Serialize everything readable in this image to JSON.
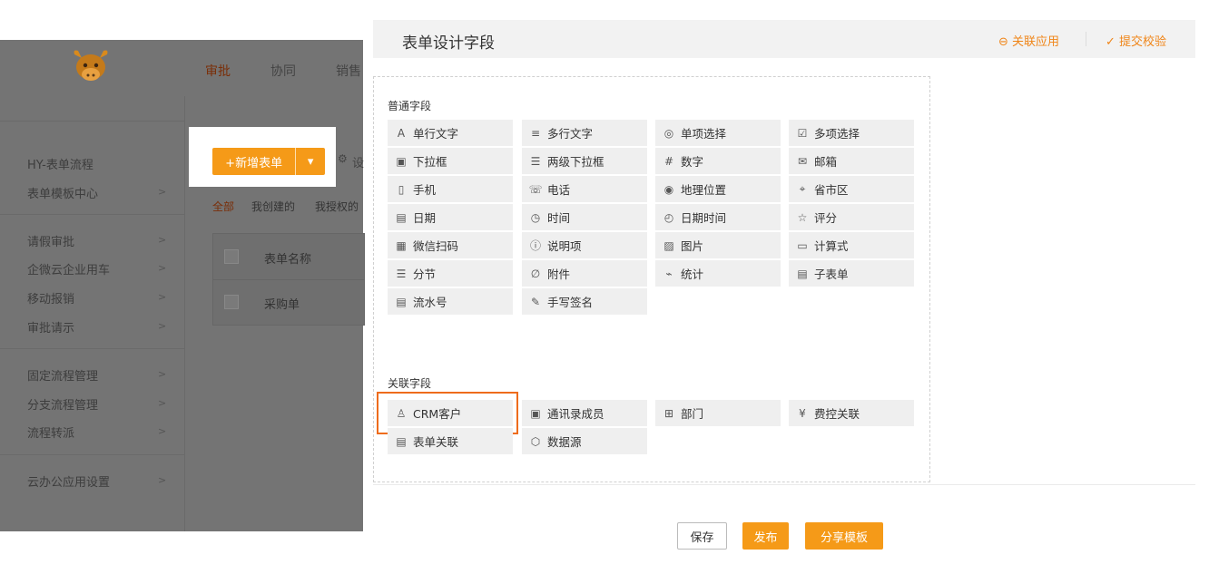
{
  "nav": {
    "items": [
      "审批",
      "协同",
      "销售"
    ]
  },
  "sidebar": {
    "group1": [
      "HY-表单流程",
      "表单模板中心"
    ],
    "group2": [
      "请假审批",
      "企微云企业用车",
      "移动报销",
      "审批请示"
    ],
    "group3": [
      "固定流程管理",
      "分支流程管理",
      "流程转派"
    ],
    "group4": [
      "云办公应用设置"
    ],
    "arrow": ">"
  },
  "toolbar": {
    "new_form": "+新增表单",
    "dropdown": "▾",
    "settings_partial": "设"
  },
  "filters": {
    "all": "全部",
    "mine": "我创建的",
    "authorized": "我授权的"
  },
  "table": {
    "header": "表单名称",
    "rows": [
      "采购单"
    ]
  },
  "panel": {
    "title": "表单设计字段",
    "link_app": "关联应用",
    "submit_check": "提交校验",
    "common_label": "普通字段",
    "related_label": "关联字段",
    "common_fields": [
      {
        "icon": "text-icon",
        "label": "单行文字"
      },
      {
        "icon": "multiline-icon",
        "label": "多行文字"
      },
      {
        "icon": "radio-icon",
        "label": "单项选择"
      },
      {
        "icon": "checkbox-icon",
        "label": "多项选择"
      },
      {
        "icon": "dropdown-icon",
        "label": "下拉框"
      },
      {
        "icon": "cascade-icon",
        "label": "两级下拉框"
      },
      {
        "icon": "number-icon",
        "label": "数字"
      },
      {
        "icon": "mail-icon",
        "label": "邮箱"
      },
      {
        "icon": "phone-icon",
        "label": "手机"
      },
      {
        "icon": "telephone-icon",
        "label": "电话"
      },
      {
        "icon": "location-icon",
        "label": "地理位置"
      },
      {
        "icon": "region-icon",
        "label": "省市区"
      },
      {
        "icon": "calendar-icon",
        "label": "日期"
      },
      {
        "icon": "clock-icon",
        "label": "时间"
      },
      {
        "icon": "datetime-icon",
        "label": "日期时间"
      },
      {
        "icon": "star-icon",
        "label": "评分"
      },
      {
        "icon": "qrcode-icon",
        "label": "微信扫码"
      },
      {
        "icon": "info-icon",
        "label": "说明项"
      },
      {
        "icon": "image-icon",
        "label": "图片"
      },
      {
        "icon": "formula-icon",
        "label": "计算式"
      },
      {
        "icon": "section-icon",
        "label": "分节"
      },
      {
        "icon": "attachment-icon",
        "label": "附件"
      },
      {
        "icon": "stats-icon",
        "label": "统计"
      },
      {
        "icon": "subform-icon",
        "label": "子表单"
      },
      {
        "icon": "serial-icon",
        "label": "流水号"
      },
      {
        "icon": "signature-icon",
        "label": "手写签名"
      }
    ],
    "related_fields": [
      {
        "icon": "user-icon",
        "label": "CRM客户"
      },
      {
        "icon": "contacts-icon",
        "label": "通讯录成员"
      },
      {
        "icon": "org-icon",
        "label": "部门"
      },
      {
        "icon": "yuan-icon",
        "label": "费控关联"
      },
      {
        "icon": "form-link-icon",
        "label": "表单关联"
      },
      {
        "icon": "cube-icon",
        "label": "数据源"
      }
    ]
  },
  "footer": {
    "save": "保存",
    "publish": "发布",
    "share": "分享模板"
  },
  "colors": {
    "accent": "#f59a18",
    "highlight_outline": "#ee6c1c",
    "overlay": "#747474"
  }
}
